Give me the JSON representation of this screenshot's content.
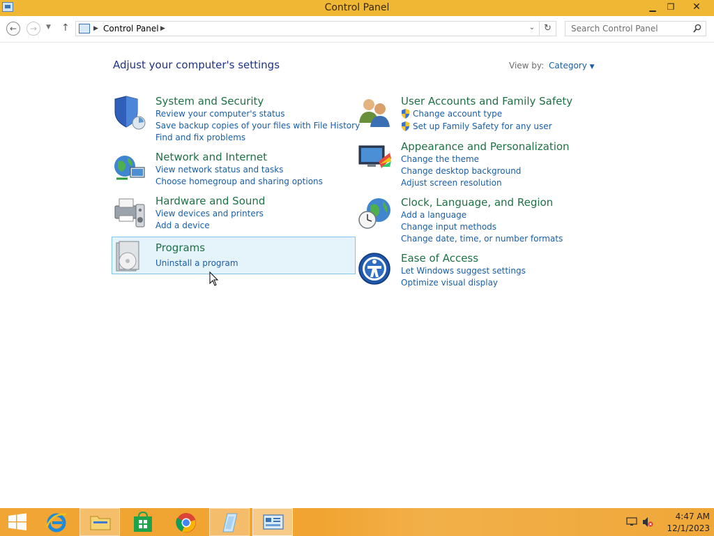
{
  "window": {
    "title": "Control Panel"
  },
  "address": {
    "crumb": "Control Panel"
  },
  "search": {
    "placeholder": "Search Control Panel"
  },
  "page": {
    "heading": "Adjust your computer's settings",
    "view_by_label": "View by:",
    "view_by_value": "Category"
  },
  "categories": {
    "system": {
      "title": "System and Security",
      "links": [
        "Review your computer's status",
        "Save backup copies of your files with File History",
        "Find and fix problems"
      ]
    },
    "network": {
      "title": "Network and Internet",
      "links": [
        "View network status and tasks",
        "Choose homegroup and sharing options"
      ]
    },
    "hardware": {
      "title": "Hardware and Sound",
      "links": [
        "View devices and printers",
        "Add a device"
      ]
    },
    "programs": {
      "title": "Programs",
      "links": [
        "Uninstall a program"
      ]
    },
    "users": {
      "title": "User Accounts and Family Safety",
      "links": [
        "Change account type",
        "Set up Family Safety for any user"
      ]
    },
    "appearance": {
      "title": "Appearance and Personalization",
      "links": [
        "Change the theme",
        "Change desktop background",
        "Adjust screen resolution"
      ]
    },
    "clock": {
      "title": "Clock, Language, and Region",
      "links": [
        "Add a language",
        "Change input methods",
        "Change date, time, or number formats"
      ]
    },
    "ease": {
      "title": "Ease of Access",
      "links": [
        "Let Windows suggest settings",
        "Optimize visual display"
      ]
    }
  },
  "taskbar": {
    "time": "4:47 AM",
    "date": "12/1/2023"
  }
}
